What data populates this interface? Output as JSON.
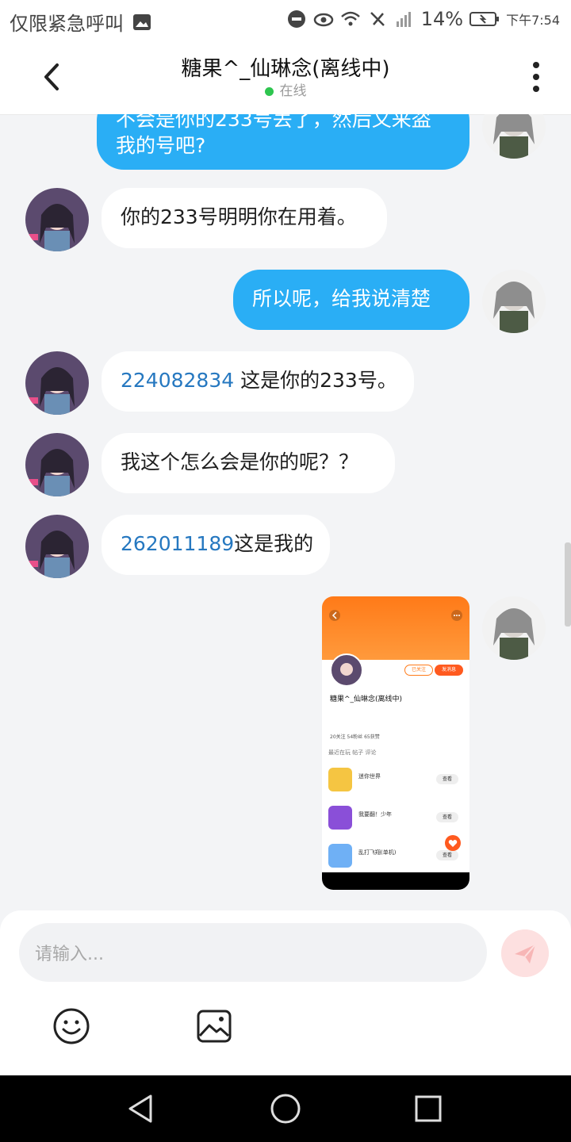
{
  "status_bar": {
    "left_text": "仅限紧急呼叫",
    "battery": "14%",
    "time": "下午7:54"
  },
  "header": {
    "title": "糖果^_仙琳念(离线中)",
    "presence": "在线"
  },
  "messages": [
    {
      "side": "out",
      "line1": "不会是你的233号丢了，然后又来盗",
      "line2": "我的号吧?"
    },
    {
      "side": "in",
      "text": "你的233号明明你在用着。"
    },
    {
      "side": "out",
      "text": "所以呢，给我说清楚"
    },
    {
      "side": "in",
      "number": "224082834",
      "text": " 这是你的233号。"
    },
    {
      "side": "in",
      "text": "我这个怎么会是你的呢？？"
    },
    {
      "side": "in",
      "number": "262011189",
      "text": "这是我的"
    }
  ],
  "shared_screenshot": {
    "name": "糖果^_仙琳念(离线中)",
    "tabs": "最近在玩    帖子    评论",
    "follow": "已关注",
    "message": "发消息",
    "stats": "20关注   54粉丝   65获赞",
    "games": [
      {
        "name": "迷你世界",
        "action": "查看"
      },
      {
        "name": "我要翻！少年",
        "action": "查看"
      },
      {
        "name": "乱打飞翔(单机)",
        "action": "查看"
      }
    ]
  },
  "input": {
    "placeholder": "请输入..."
  },
  "colors": {
    "out_bubble": "#2aaef5",
    "number_link": "#2678c0",
    "online_dot": "#2ec54f"
  },
  "icons": {
    "back": "chevron-left-icon",
    "more": "more-vertical-icon",
    "send": "send-icon",
    "emoji": "emoji-icon",
    "image": "image-icon"
  }
}
